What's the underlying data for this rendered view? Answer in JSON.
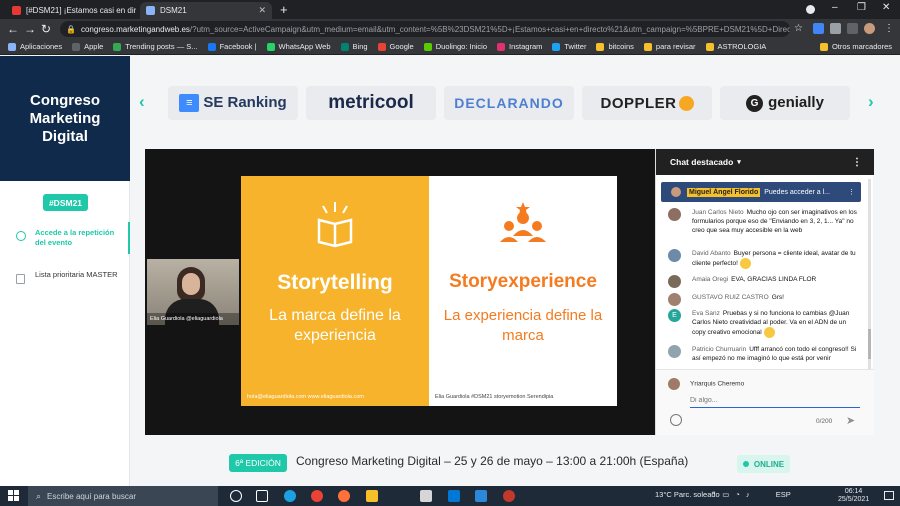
{
  "browser": {
    "tabs": [
      {
        "title": "[#DSM21] ¡Estamos casi en direc",
        "active": false
      },
      {
        "title": "DSM21",
        "active": true
      }
    ],
    "url_host": "congreso.marketingandweb.es",
    "url_rest": "/?utm_source=ActiveCampaign&utm_medium=email&utm_content=%5B%23DSM21%5D+¡Estamos+casi+en+directo%21&utm_campaign=%5BPRE+DSM21%5D+Directo",
    "bookmarks": [
      {
        "label": "Aplicaciones",
        "color": "#8ab4f8"
      },
      {
        "label": "Apple",
        "color": "#5f6368"
      },
      {
        "label": "Trending posts — S...",
        "color": "#34a853"
      },
      {
        "label": "Facebook |",
        "color": "#1877f2"
      },
      {
        "label": "WhatsApp Web",
        "color": "#25d366"
      },
      {
        "label": "Bing",
        "color": "#008373"
      },
      {
        "label": "Google",
        "color": "#ea4335"
      },
      {
        "label": "Duolingo: Inicio",
        "color": "#58cc02"
      },
      {
        "label": "Instagram",
        "color": "#e1306c"
      },
      {
        "label": "Twitter",
        "color": "#1da1f2"
      },
      {
        "label": "bitcoins",
        "color": "#f6c02b"
      },
      {
        "label": "para revisar",
        "color": "#f6c02b"
      },
      {
        "label": "ASTROLOGIA",
        "color": "#f6c02b"
      }
    ],
    "other_bookmarks": "Otros marcadores"
  },
  "sidebar": {
    "brand": "Congreso Marketing Digital",
    "hashtag": "#DSM21",
    "items": [
      {
        "label": "Accede a la repetición del evento",
        "active": true
      },
      {
        "label": "Lista prioritaria MASTER",
        "active": false
      }
    ]
  },
  "sponsors": {
    "seranking": "SE Ranking",
    "seranking_mark": "≡",
    "metricool": "metricool",
    "declarando": "DECLARANDO",
    "doppler": "DOPPLER",
    "genially": "genially",
    "genially_mark": "G"
  },
  "slide": {
    "left_heading": "Storytelling",
    "left_sub": "La marca define la experiencia",
    "right_heading": "Storyexperience",
    "right_sub": "La experiencia define la marca",
    "left_footer": "hola@eliaguardiola.com     www.eliaguardiola.com",
    "right_footer": "Elia Guardiola  #DSM21   storyemotion   Serendipia"
  },
  "camera": {
    "label": "Elia Guardiola @eliaguardiola"
  },
  "chat": {
    "title": "Chat destacado",
    "pinned_author": "Miguel Ángel Florido",
    "pinned_text": "Puedes acceder a l...",
    "messages": [
      {
        "author": "Juan Carlos Nieto",
        "text": "Mucho ojo con ser imaginativos en los formularios porque eso de \"Enviando en 3, 2, 1... Ya\" no creo que sea muy accesible en la web",
        "color": "#8d6e63"
      },
      {
        "author": "David Abanto",
        "text": "Buyer persona = cliente ideal, avatar de tu cliente perfecto!",
        "color": "#6d8aa8"
      },
      {
        "author": "Amaia Oregi",
        "text": "EVA, GRACIAS LINDA FLOR",
        "color": "#7a6a5a"
      },
      {
        "author": "GUSTAVO RUIZ CASTRO",
        "text": "Grs!",
        "color": "#a08070"
      },
      {
        "author": "Eva Sanz",
        "text": "Pruebas y si no funciona lo cambias @Juan Carlos Nieto creatividad al poder. Va en el ADN de un copy creativo emocional",
        "color": "#26a69a",
        "initial": "E"
      },
      {
        "author": "Patricio Churruarin",
        "text": "Ufff arrancó con todo el congreso!! Si así empezó no me imaginó lo que está por venir",
        "color": "#90a4ae"
      }
    ],
    "current_user": "Yriarquis Cheremo",
    "input_placeholder": "Di algo...",
    "char_count": "0/200"
  },
  "info": {
    "edition": "6ª EDICIÓN",
    "event": "Congreso Marketing Digital – 25 y 26 de mayo – 13:00 a 21:00h (España)",
    "status": "ONLINE"
  },
  "taskbar": {
    "search_placeholder": "Escribe aquí para buscar",
    "weather": "13°C  Parc. soleado",
    "lang": "ESP",
    "time": "06:14",
    "date": "25/5/2021"
  }
}
